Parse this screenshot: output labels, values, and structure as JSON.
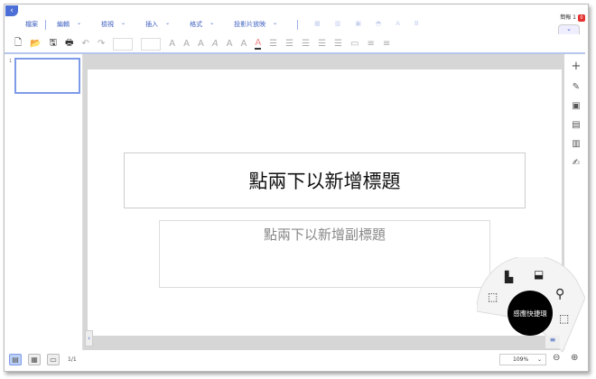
{
  "header": {
    "back_icon": "chevron-left",
    "document_name": "簡報 1",
    "notification_count": "0"
  },
  "menu": [
    "檔案",
    "編輯",
    "檢視",
    "插入",
    "格式",
    "投影片放映"
  ],
  "slide": {
    "title_placeholder": "點兩下以新增標題",
    "subtitle_placeholder": "點兩下以新增副標題",
    "thumbnail_number": "1"
  },
  "quick_ring": {
    "label": "感應快捷環"
  },
  "status": {
    "page": "1/1",
    "zoom": "109%"
  }
}
